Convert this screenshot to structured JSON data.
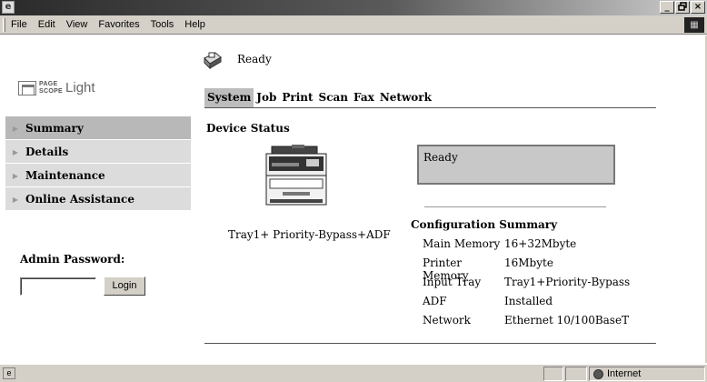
{
  "menubar": {
    "items": [
      "File",
      "Edit",
      "View",
      "Favorites",
      "Tools",
      "Help"
    ]
  },
  "window_buttons": [
    "_",
    " ",
    "×"
  ],
  "brand": {
    "mark_line1": "PAGE",
    "mark_line2": "SCOPE",
    "name": "Light"
  },
  "status": {
    "text": "Ready"
  },
  "tabs": [
    "System",
    "Job",
    "Print",
    "Scan",
    "Fax",
    "Network"
  ],
  "sidebar": {
    "items": [
      "Summary",
      "Details",
      "Maintenance",
      "Online Assistance"
    ]
  },
  "admin": {
    "label": "Admin Password:",
    "login_label": "Login",
    "password_value": ""
  },
  "device_status": {
    "title": "Device Status",
    "message": "Ready",
    "trays": "Tray1+ Priority-Bypass+ADF"
  },
  "config": {
    "title": "Configuration Summary",
    "rows": [
      {
        "key": "Main Memory",
        "value": "16+32Mbyte"
      },
      {
        "key": "Printer Memory",
        "value": "16Mbyte"
      },
      {
        "key": "Input Tray",
        "value": "Tray1+Priority-Bypass"
      },
      {
        "key": "ADF",
        "value": "Installed"
      },
      {
        "key": "Network",
        "value": "Ethernet 10/100BaseT"
      }
    ]
  },
  "statusbar": {
    "zone": "Internet"
  }
}
